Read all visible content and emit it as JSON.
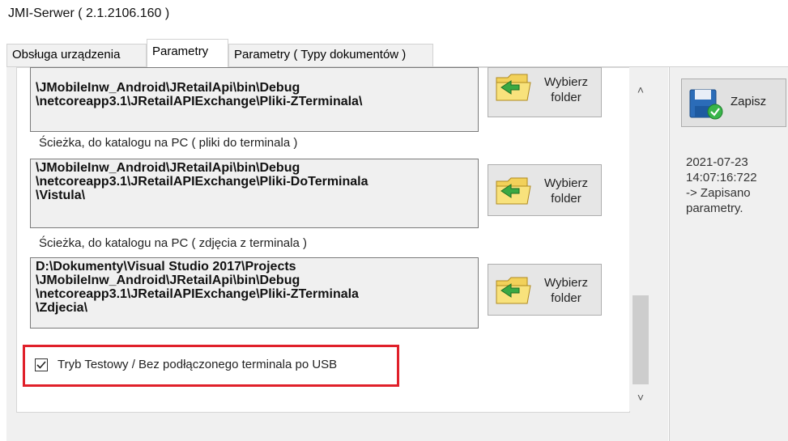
{
  "window": {
    "title": "JMI-Serwer ( 2.1.2106.160 )"
  },
  "tabs": [
    {
      "label": "Obsługa urządzenia",
      "active": false
    },
    {
      "label": "Parametry",
      "active": true
    },
    {
      "label": "Parametry ( Typy dokumentów )",
      "active": false
    }
  ],
  "groups": [
    {
      "title": "",
      "path_lines": [
        "\\JMobileInw_Android\\JRetailApi\\bin\\Debug",
        "\\netcoreapp3.1\\JRetailAPIExchange\\Pliki-ZTerminala\\"
      ],
      "button_label": [
        "Wybierz",
        "folder"
      ]
    },
    {
      "title": "Ścieżka, do katalogu na PC ( pliki do terminala )",
      "path_lines": [
        "\\JMobileInw_Android\\JRetailApi\\bin\\Debug",
        "\\netcoreapp3.1\\JRetailAPIExchange\\Pliki-DoTerminala",
        "\\Vistula\\"
      ],
      "button_label": [
        "Wybierz",
        "folder"
      ]
    },
    {
      "title": "Ścieżka, do katalogu na PC ( zdjęcia z terminala )",
      "path_lines": [
        "D:\\Dokumenty\\Visual Studio 2017\\Projects",
        "\\JMobileInw_Android\\JRetailApi\\bin\\Debug",
        "\\netcoreapp3.1\\JRetailAPIExchange\\Pliki-ZTerminala",
        "\\Zdjecia\\"
      ],
      "button_label": [
        "Wybierz",
        "folder"
      ]
    }
  ],
  "test_mode": {
    "label": "Tryb Testowy / Bez podłączonego terminala po USB",
    "checked": true
  },
  "scroll": {
    "up_glyph": "˄",
    "down_glyph": "˅"
  },
  "save": {
    "label": "Zapisz"
  },
  "status_log": [
    "2021-07-23",
    "14:07:16:722",
    "-> Zapisano",
    "parametry."
  ],
  "colors": {
    "highlight": "#e0202a",
    "panel": "#f0f0f0",
    "save_icon": "#2b6cb8",
    "check_icon": "#39b54a"
  },
  "icons": {
    "folder": "folder-arrow-icon",
    "save": "floppy-check-icon",
    "checkbox": "checkmark-icon"
  }
}
